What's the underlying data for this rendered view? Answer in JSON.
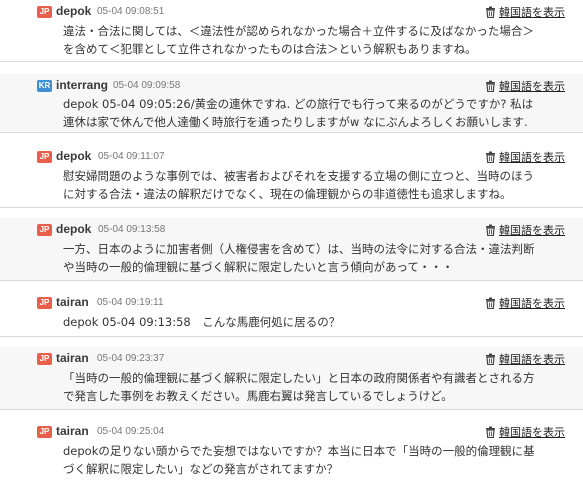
{
  "comments": [
    {
      "flag": "JP",
      "author": "depok",
      "time": "05-04 09:08:51",
      "translate_label": "韓国語を表示",
      "lines": [
        "違法・合法に関しては、＜違法性が認められなかった場合＋立件するに及ばなかった場合＞を含めて＜犯罪として立件されなかったものは合法＞という解釈もありますね。"
      ]
    },
    {
      "flag": "KR",
      "author": "interrang",
      "time": "05-04 09:09:58",
      "translate_label": "韓国語を表示",
      "lines": [
        "depok 05-04 09:05:26/黄金の連休ですね. どの旅行でも行って来るのがどうですか? 私は連休は家で休んで他人達働く時旅行を通ったりしますがw なにぶんよろしくお願いします."
      ]
    },
    {
      "flag": "JP",
      "author": "depok",
      "time": "05-04 09:11:07",
      "translate_label": "韓国語を表示",
      "lines": [
        "慰安婦問題のような事例では、被害者およびそれを支援する立場の側に立つと、当時のほうに対する合法・違法の解釈だけでなく、現在の倫理観からの非道徳性も追求しますね。"
      ]
    },
    {
      "flag": "JP",
      "author": "depok",
      "time": "05-04 09:13:58",
      "translate_label": "韓国語を表示",
      "lines": [
        "一方、日本のように加害者側（人権侵害を含めて）は、当時の法令に対する合法・違法判断や当時の一般的倫理観に基づく解釈に限定したいと言う傾向があって・・・"
      ]
    },
    {
      "flag": "JP",
      "author": "tairan",
      "time": "05-04 09:19:11",
      "translate_label": "韓国語を表示",
      "lines": [
        "depok 05-04 09:13:58　こんな馬鹿何処に居るの？"
      ]
    },
    {
      "flag": "JP",
      "author": "tairan",
      "time": "05-04 09:23:37",
      "translate_label": "韓国語を表示",
      "lines": [
        "「当時の一般的倫理観に基づく解釈に限定したい」と日本の政府関係者や有識者とされる方で発言した事例をお教えください。馬鹿右翼は発言しているでしょうけど。"
      ]
    },
    {
      "flag": "JP",
      "author": "tairan",
      "time": "05-04 09:25:04",
      "translate_label": "韓国語を表示",
      "lines": [
        "depokの足りない頭からでた妄想ではないですか？本当に日本で「当時の一般的倫理観に基づく解釈に限定したい」などの発言がされてますか？"
      ]
    }
  ]
}
